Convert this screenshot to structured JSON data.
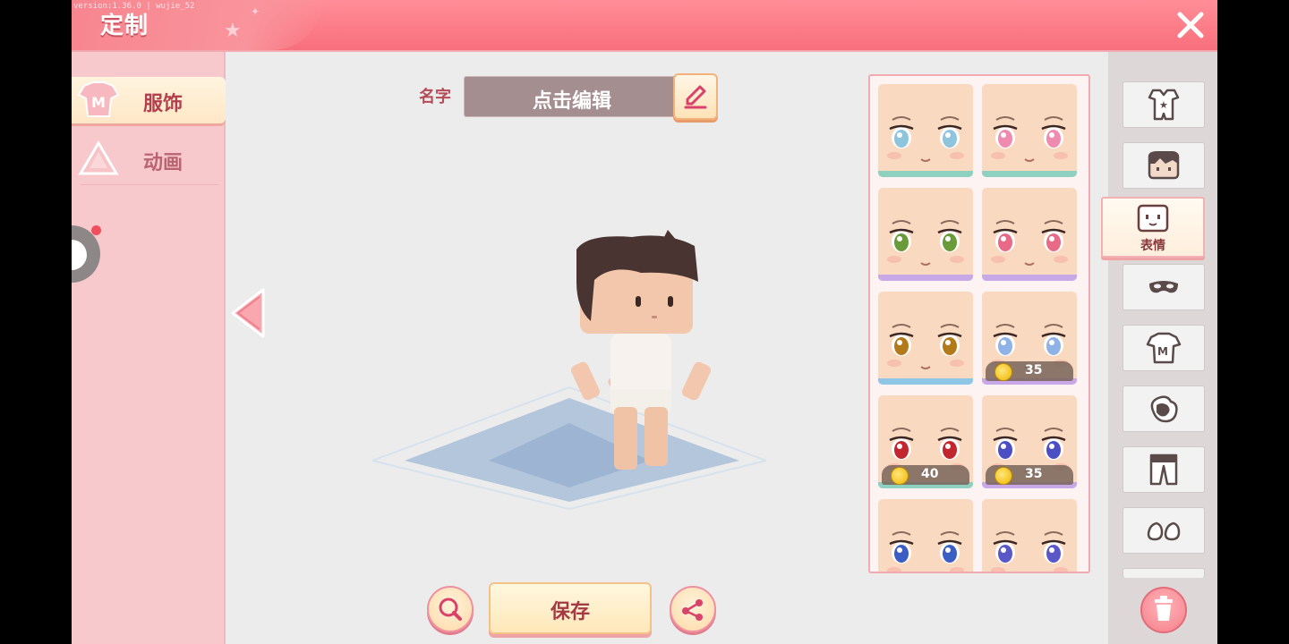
{
  "header": {
    "title": "定制",
    "debug_text": "version:1.36.0 | wujie_52"
  },
  "left_nav": {
    "items": [
      {
        "label": "服饰",
        "active": true
      },
      {
        "label": "动画",
        "active": false
      }
    ]
  },
  "name_field": {
    "label": "名字",
    "value": "点击编辑"
  },
  "save_button": {
    "label": "保存"
  },
  "expression_grid": {
    "items": [
      {
        "eye_color": "#8fc4dd",
        "accent": "#8fd1c0",
        "price": null
      },
      {
        "eye_color": "#f08bb0",
        "accent": "#8fd1c0",
        "price": null
      },
      {
        "eye_color": "#6a9b3a",
        "accent": "#c8a8e6",
        "price": null
      },
      {
        "eye_color": "#e96a86",
        "accent": "#c8a8e6",
        "price": null
      },
      {
        "eye_color": "#b37a1a",
        "accent": "#8fc6e6",
        "price": null
      },
      {
        "eye_color": "#8fb3e6",
        "accent": "#c8a8e6",
        "price": "35"
      },
      {
        "eye_color": "#c2262e",
        "accent": "#8fd1c0",
        "price": "40"
      },
      {
        "eye_color": "#4c4fc4",
        "accent": "#c8a8e6",
        "price": "35"
      },
      {
        "eye_color": "#3c5ec4",
        "accent": "#8fd1c0",
        "price": null
      },
      {
        "eye_color": "#5a57c8",
        "accent": "#c8a8e6",
        "price": null
      }
    ]
  },
  "categories": [
    {
      "icon": "outfit-icon"
    },
    {
      "icon": "hair-icon"
    },
    {
      "icon": "face-icon",
      "label": "表情",
      "active": true
    },
    {
      "icon": "mask-icon"
    },
    {
      "icon": "shirt-icon"
    },
    {
      "icon": "glove-icon"
    },
    {
      "icon": "pants-icon"
    },
    {
      "icon": "shoes-icon"
    }
  ],
  "colors": {
    "header": "#f86f7c",
    "accent": "#b4404e",
    "panel": "#f8c9cc"
  }
}
